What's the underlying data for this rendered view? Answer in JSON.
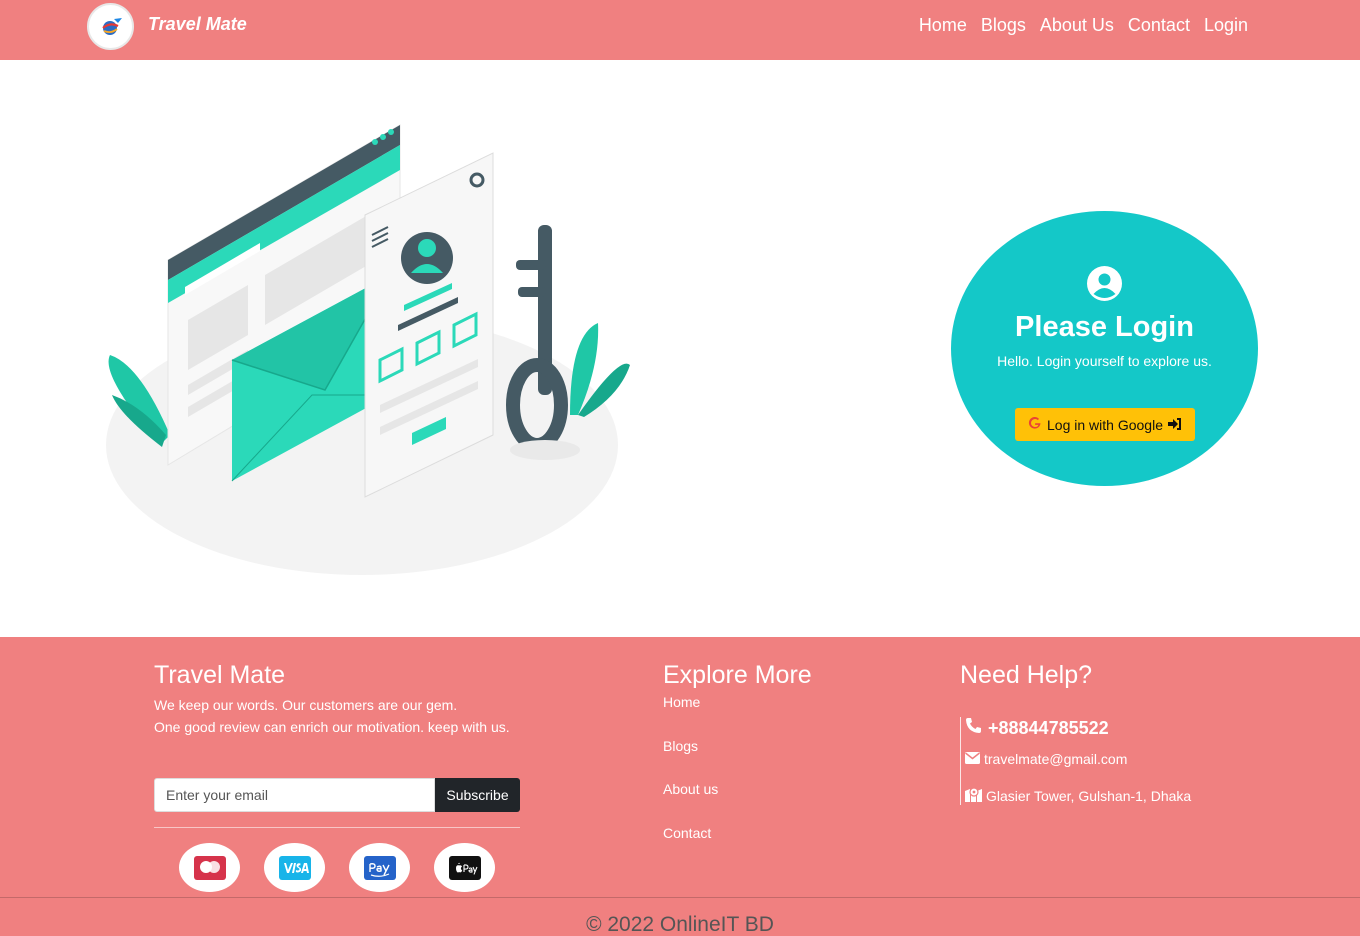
{
  "navbar": {
    "brand": "Travel Mate",
    "logo_icon": "globe-plane-logo-icon",
    "links": [
      "Home",
      "Blogs",
      "About Us",
      "Contact",
      "Login"
    ]
  },
  "login": {
    "icon": "user-circle-icon",
    "title": "Please Login",
    "subtitle": "Hello. Login yourself to explore us.",
    "google_button": "Log in with Google"
  },
  "footer": {
    "about": {
      "title": "Travel Mate",
      "line1": "We keep our words. Our customers are our gem.",
      "line2": "One good review can enrich our motivation. keep with us.",
      "email_placeholder": "Enter your email",
      "subscribe_label": "Subscribe",
      "payments": [
        "mastercard-icon",
        "visa-icon",
        "amazon-pay-icon",
        "apple-pay-icon"
      ]
    },
    "explore": {
      "title": "Explore More",
      "links": [
        "Home",
        "Blogs",
        "About us",
        "Contact"
      ]
    },
    "help": {
      "title": "Need Help?",
      "phone": "+88844785522",
      "email": "travelmate@gmail.com",
      "address": "Glasier Tower, Gulshan-1, Dhaka"
    },
    "copyright": "© 2022 OnlineIT BD"
  },
  "colors": {
    "primary": "#f08080",
    "accent": "#14c8c8",
    "button_yellow": "#ffc107",
    "dark": "#212529",
    "illustration_teal": "#2bd9b9"
  }
}
